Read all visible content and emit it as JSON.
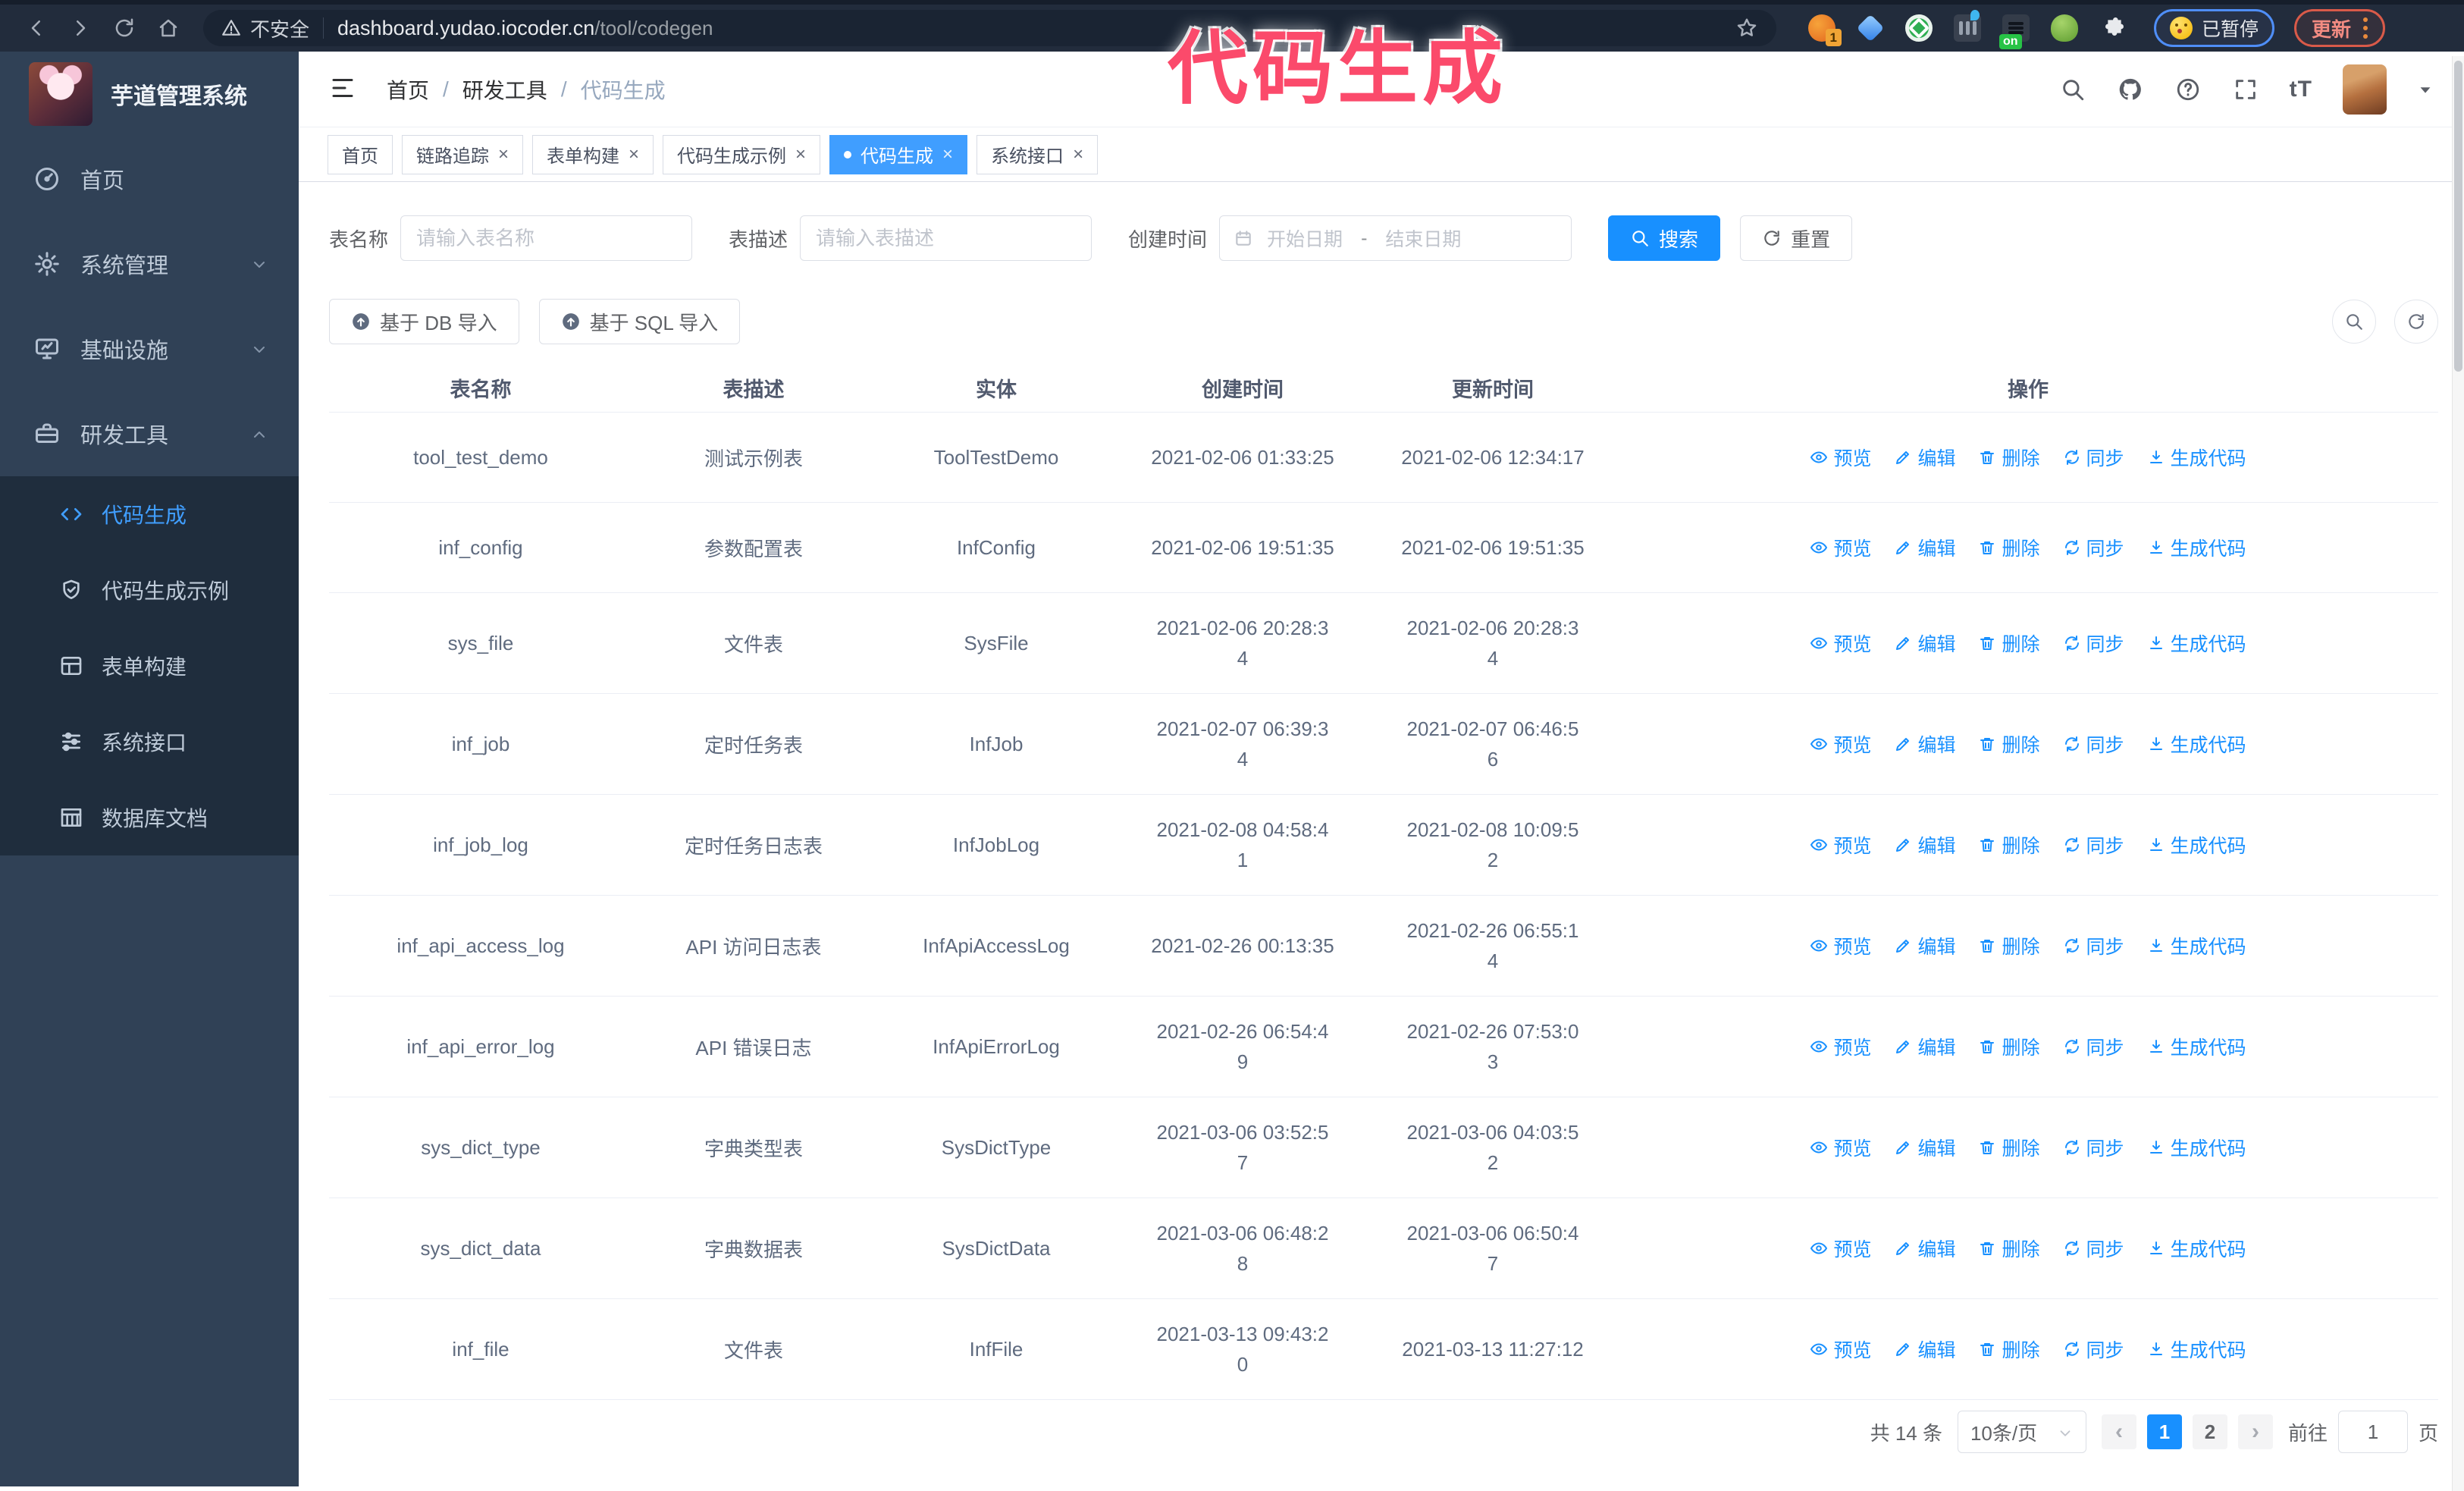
{
  "browser": {
    "security_label": "不安全",
    "url_host": "dashboard.yudao.iocoder.cn",
    "url_path": "/tool/codegen",
    "extension_badge": "1",
    "extension_on_badge": "on",
    "paused_badge": "已暂停",
    "update_button": "更新"
  },
  "annotation": {
    "text": "代码生成",
    "color": "#fb4a6b"
  },
  "sidebar": {
    "title": "芋道管理系统",
    "items": [
      {
        "label": "首页",
        "icon": "dashboard-icon",
        "chevron": ""
      },
      {
        "label": "系统管理",
        "icon": "gear-icon",
        "chevron": "down"
      },
      {
        "label": "基础设施",
        "icon": "monitor-icon",
        "chevron": "down"
      },
      {
        "label": "研发工具",
        "icon": "briefcase-icon",
        "chevron": "up"
      }
    ],
    "subitems": [
      {
        "label": "代码生成",
        "icon": "code-icon",
        "active": true
      },
      {
        "label": "代码生成示例",
        "icon": "shield-check-icon",
        "active": false
      },
      {
        "label": "表单构建",
        "icon": "form-icon",
        "active": false
      },
      {
        "label": "系统接口",
        "icon": "sliders-icon",
        "active": false
      },
      {
        "label": "数据库文档",
        "icon": "database-doc-icon",
        "active": false
      }
    ]
  },
  "header": {
    "breadcrumb": [
      "首页",
      "研发工具",
      "代码生成"
    ],
    "breadcrumb_separator": "/",
    "font_icon_label": "tT"
  },
  "tabs": {
    "close_glyph": "×",
    "items": [
      {
        "label": "首页",
        "closable": false,
        "active": false
      },
      {
        "label": "链路追踪",
        "closable": true,
        "active": false
      },
      {
        "label": "表单构建",
        "closable": true,
        "active": false
      },
      {
        "label": "代码生成示例",
        "closable": true,
        "active": false
      },
      {
        "label": "代码生成",
        "closable": true,
        "active": true
      },
      {
        "label": "系统接口",
        "closable": true,
        "active": false
      }
    ]
  },
  "search": {
    "name_label": "表名称",
    "name_placeholder": "请输入表名称",
    "desc_label": "表描述",
    "desc_placeholder": "请输入表描述",
    "time_label": "创建时间",
    "start_placeholder": "开始日期",
    "separator": "-",
    "end_placeholder": "结束日期",
    "search_button": "搜索",
    "reset_button": "重置"
  },
  "toolbar": {
    "import_db": "基于 DB 导入",
    "import_sql": "基于 SQL 导入"
  },
  "table": {
    "columns": [
      "表名称",
      "表描述",
      "实体",
      "创建时间",
      "更新时间",
      "操作"
    ],
    "op_labels": [
      "预览",
      "编辑",
      "删除",
      "同步",
      "生成代码"
    ],
    "rows": [
      {
        "name": "tool_test_demo",
        "desc": "测试示例表",
        "entity": "ToolTestDemo",
        "created": "2021-02-06 01:33:25",
        "updated": "2021-02-06 12:34:17"
      },
      {
        "name": "inf_config",
        "desc": "参数配置表",
        "entity": "InfConfig",
        "created": "2021-02-06 19:51:35",
        "updated": "2021-02-06 19:51:35"
      },
      {
        "name": "sys_file",
        "desc": "文件表",
        "entity": "SysFile",
        "created": "2021-02-06 20:28:3\n4",
        "updated": "2021-02-06 20:28:3\n4"
      },
      {
        "name": "inf_job",
        "desc": "定时任务表",
        "entity": "InfJob",
        "created": "2021-02-07 06:39:3\n4",
        "updated": "2021-02-07 06:46:5\n6"
      },
      {
        "name": "inf_job_log",
        "desc": "定时任务日志表",
        "entity": "InfJobLog",
        "created": "2021-02-08 04:58:4\n1",
        "updated": "2021-02-08 10:09:5\n2"
      },
      {
        "name": "inf_api_access_log",
        "desc": "API 访问日志表",
        "entity": "InfApiAccessLog",
        "created": "2021-02-26 00:13:35",
        "updated": "2021-02-26 06:55:1\n4"
      },
      {
        "name": "inf_api_error_log",
        "desc": "API 错误日志",
        "entity": "InfApiErrorLog",
        "created": "2021-02-26 06:54:4\n9",
        "updated": "2021-02-26 07:53:0\n3"
      },
      {
        "name": "sys_dict_type",
        "desc": "字典类型表",
        "entity": "SysDictType",
        "created": "2021-03-06 03:52:5\n7",
        "updated": "2021-03-06 04:03:5\n2"
      },
      {
        "name": "sys_dict_data",
        "desc": "字典数据表",
        "entity": "SysDictData",
        "created": "2021-03-06 06:48:2\n8",
        "updated": "2021-03-06 06:50:4\n7"
      },
      {
        "name": "inf_file",
        "desc": "文件表",
        "entity": "InfFile",
        "created": "2021-03-13 09:43:2\n0",
        "updated": "2021-03-13 11:27:12"
      }
    ]
  },
  "pagination": {
    "total": "共 14 条",
    "page_size": "10条/页",
    "prev_glyph": "‹",
    "next_glyph": "›",
    "pages": [
      "1",
      "2"
    ],
    "active_page": "1",
    "goto_label": "前往",
    "goto_value": "1",
    "goto_suffix": "页"
  },
  "colors": {
    "primary": "#1890ff",
    "sidebar_bg": "#304156",
    "submenu_bg": "#1f2d3d",
    "active_blue": "#409eff",
    "annotation_pink": "#fb4a6b"
  }
}
